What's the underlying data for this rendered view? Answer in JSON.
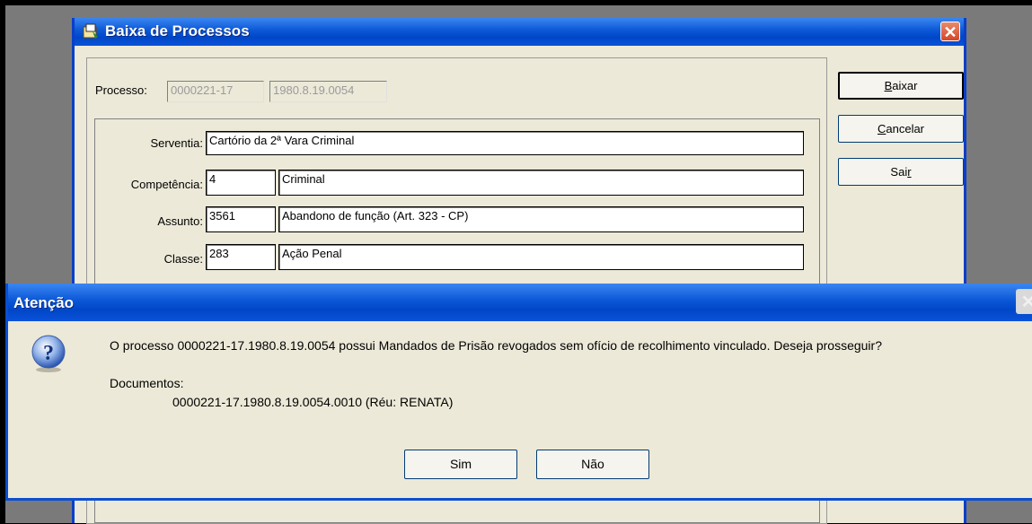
{
  "main_window": {
    "title": "Baixa de Processos",
    "close_glyph": "✕",
    "processo_label": "Processo:",
    "processo_num": "0000221-17",
    "processo_suffix": "1980.8.19.0054",
    "fields": {
      "serventia": {
        "label": "Serventia:",
        "value": "Cartório da 2ª Vara Criminal"
      },
      "competencia": {
        "label": "Competência:",
        "code": "4",
        "value": "Criminal"
      },
      "assunto": {
        "label": "Assunto:",
        "code": "3561",
        "value": "Abandono de função  (Art. 323 - CP)"
      },
      "classe": {
        "label": "Classe:",
        "code": "283",
        "value": "Ação Penal"
      }
    },
    "buttons": {
      "baixar": {
        "mnemonic": "B",
        "rest": "aixar"
      },
      "cancelar": {
        "mnemonic": "C",
        "rest": "ancelar"
      },
      "sair": {
        "pre": "Sai",
        "mnemonic": "r"
      }
    }
  },
  "dialog": {
    "title": "Atenção",
    "close_glyph": "✕",
    "icon": "question-icon",
    "message": "O processo 0000221-17.1980.8.19.0054 possui Mandados de Prisão revogados sem ofício de recolhimento vinculado. Deseja prosseguir?",
    "documents_label": "Documentos:",
    "document_item": "0000221-17.1980.8.19.0054.0010 (Réu: RENATA)",
    "buttons": {
      "yes": "Sim",
      "no": "Não"
    }
  },
  "colors": {
    "titlebar": "#0b57d6",
    "window_bg": "#ece9d8",
    "close_red": "#d4472a"
  }
}
